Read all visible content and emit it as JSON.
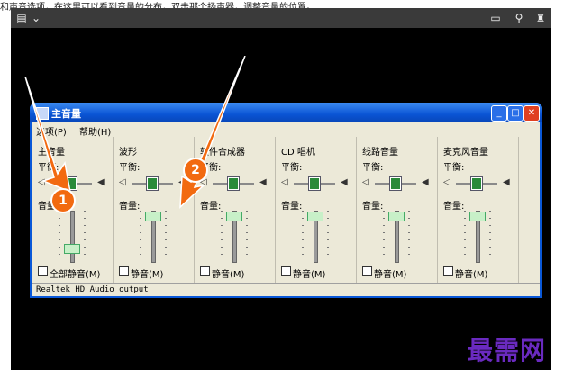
{
  "top_text": "和声音选项，在这里可以看到音量的分布，双击那个扬声器，调整音量的位置。",
  "viewer": {
    "toolbar_left_icons": [
      "gallery-icon",
      "chevron-down-icon"
    ],
    "toolbar_right_icons": [
      "comment-icon",
      "pin-icon",
      "shirt-icon"
    ]
  },
  "window": {
    "title": "主音量",
    "menu": [
      "选项(P)",
      "帮助(H)"
    ],
    "panels": [
      {
        "title": "主音量",
        "balance_label": "平衡:",
        "volume_label": "音量:",
        "mute_label": "全部静音(M)",
        "volume_level": 0.15
      },
      {
        "title": "波形",
        "balance_label": "平衡:",
        "volume_label": "音量:",
        "mute_label": "静音(M)",
        "volume_level": 0.9
      },
      {
        "title": "软件合成器",
        "balance_label": "平衡:",
        "volume_label": "音量:",
        "mute_label": "静音(M)",
        "volume_level": 0.9
      },
      {
        "title": "CD 唱机",
        "balance_label": "平衡:",
        "volume_label": "音量:",
        "mute_label": "静音(M)",
        "volume_level": 0.9
      },
      {
        "title": "线路音量",
        "balance_label": "平衡:",
        "volume_label": "音量:",
        "mute_label": "静音(M)",
        "volume_level": 0.9
      },
      {
        "title": "麦克风音量",
        "balance_label": "平衡:",
        "volume_label": "音量:",
        "mute_label": "静音(M)",
        "volume_level": 0.9
      }
    ],
    "status": "Realtek HD Audio output"
  },
  "annotations": [
    "1",
    "2"
  ],
  "watermark": "最需网",
  "colors": {
    "arrow": "#f26a10",
    "titlebar": "#0a54d4",
    "watermark": "#6a2ac0"
  }
}
